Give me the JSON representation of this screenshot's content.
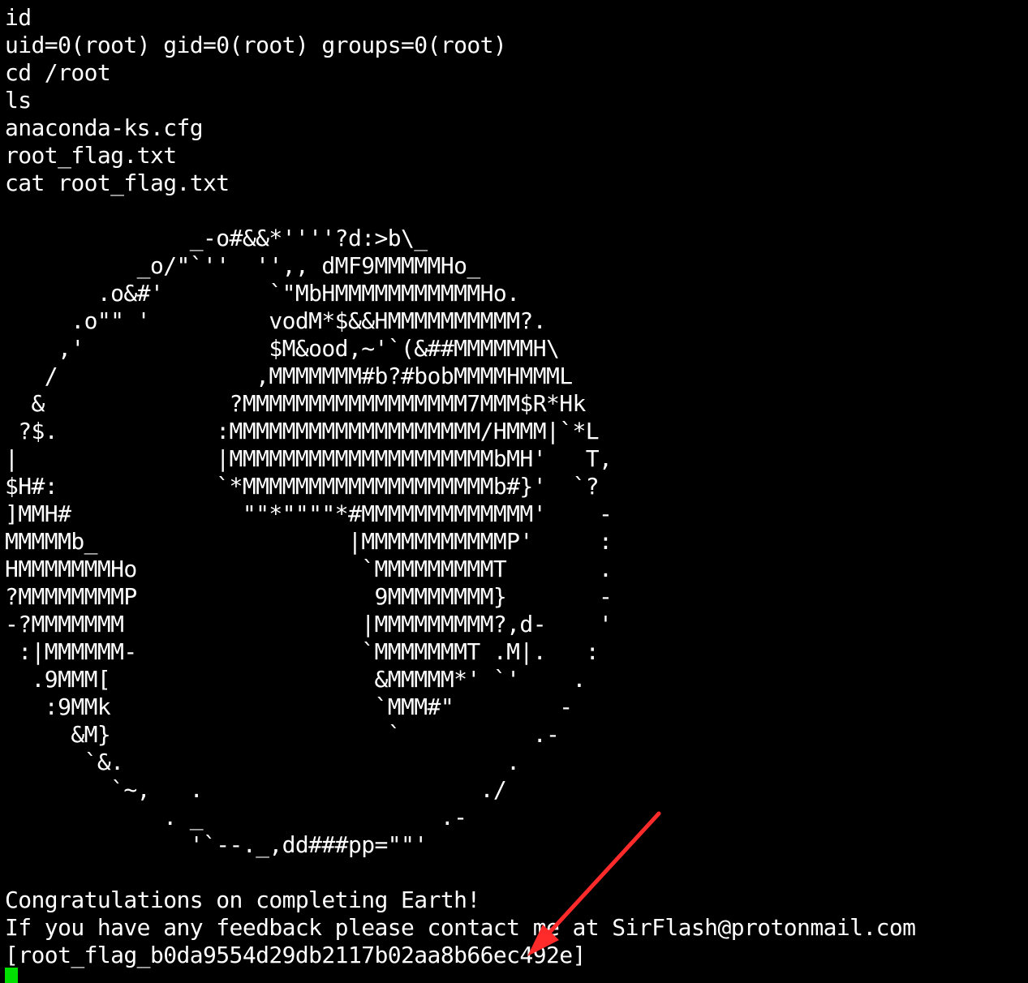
{
  "terminal": {
    "lines": [
      "id",
      "uid=0(root) gid=0(root) groups=0(root)",
      "cd /root",
      "ls",
      "anaconda-ks.cfg",
      "root_flag.txt",
      "cat root_flag.txt",
      "",
      "              _-o#&&*''''?d:>b\\_",
      "          _o/\"`''  '',, dMF9MMMMMHo_",
      "       .o&#'        `\"MbHMMMMMMMMMMMHo.",
      "     .o\"\" '         vodM*$&&HMMMMMMMMMM?.",
      "    ,'              $M&ood,~'`(&##MMMMMMH\\",
      "   /               ,MMMMMMM#b?#bobMMMMHMMML",
      "  &              ?MMMMMMMMMMMMMMMMM7MMM$R*Hk",
      " ?$.            :MMMMMMMMMMMMMMMMMMM/HMMM|`*L",
      "|               |MMMMMMMMMMMMMMMMMMMMbMH'   T,",
      "$H#:            `*MMMMMMMMMMMMMMMMMMMb#}'  `?",
      "]MMH#             \"\"*\"\"\"\"*#MMMMMMMMMMMMM'    -",
      "MMMMMb_                   |MMMMMMMMMMMP'     :",
      "HMMMMMMMHo                 `MMMMMMMMMT       .",
      "?MMMMMMMMP                  9MMMMMMMM}       -",
      "-?MMMMMMM                  |MMMMMMMMM?,d-    '",
      " :|MMMMMM-                 `MMMMMMMT .M|.   :",
      "  .9MMM[                    &MMMMM*' `'    .",
      "   :9MMk                    `MMM#\"        -",
      "     &M}                     `          .-",
      "      `&.                             .",
      "        `~,   .                     ./",
      "            . _                  .-",
      "              '`--._,dd###pp=\"\"'",
      "",
      "Congratulations on completing Earth!",
      "If you have any feedback please contact me at SirFlash@protonmail.com",
      "[root_flag_b0da9554d29db2117b02aa8b66ec492e]"
    ]
  },
  "colors": {
    "background": "#000000",
    "foreground": "#ffffff",
    "cursor": "#00e000",
    "arrow": "#ff2a2a"
  }
}
